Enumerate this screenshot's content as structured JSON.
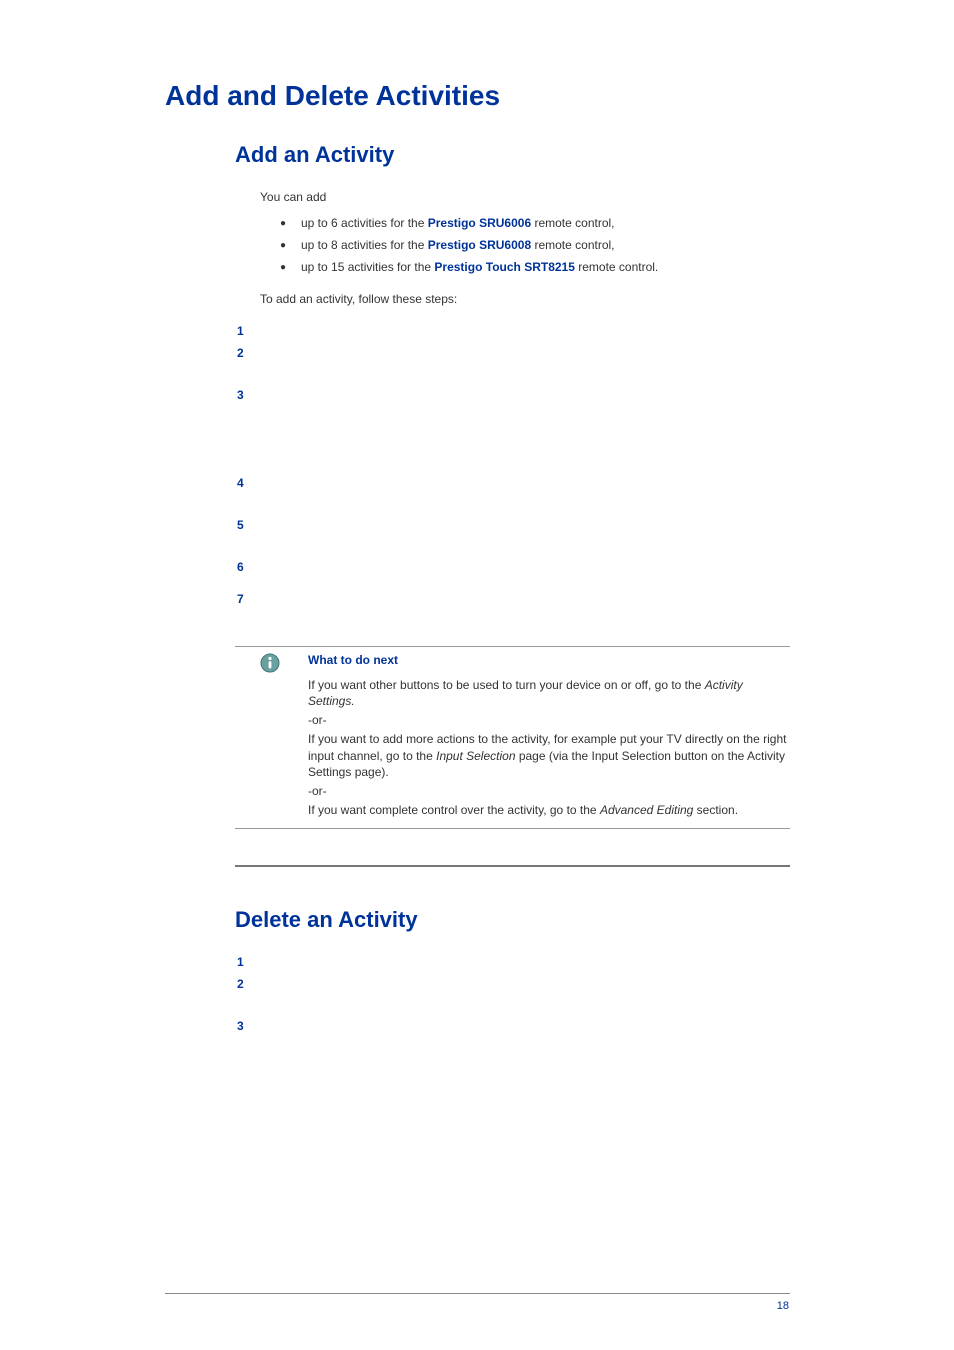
{
  "h1": "Add and Delete Activities",
  "sectionAdd": {
    "h2": "Add an Activity",
    "intro": "You can add",
    "bullets": [
      {
        "pre": "up to 6 activities for the ",
        "bold": "Prestigo SRU6006",
        "post": " remote control,"
      },
      {
        "pre": "up to 8 activities for the ",
        "bold": "Prestigo SRU6008",
        "post": " remote control,"
      },
      {
        "pre": "up to 15 activities for the ",
        "bold": "Prestigo Touch SRT8215",
        "post": " remote control."
      }
    ],
    "follow": "To add an activity, follow these steps:",
    "stepNumbers": [
      "1",
      "2",
      "3",
      "4",
      "5",
      "6",
      "7"
    ],
    "info": {
      "heading": "What to do next",
      "p1a": "If you want other buttons to be used to turn your device on or off, go to the ",
      "p1b": "Activity Settings.",
      "or": "-or-",
      "p2a": "If you want to add more actions to the activity, for example put your TV directly on the right input channel, go to the ",
      "p2b": "Input Selection",
      "p2c": " page (via the Input Selection button on the Activity Settings page).",
      "p3a": "If you want complete control over the activity, go to the ",
      "p3b": "Advanced Editing",
      "p3c": " section."
    }
  },
  "sectionDelete": {
    "h2": "Delete an Activity",
    "stepNumbers": [
      "1",
      "2",
      "3"
    ]
  },
  "pageNumber": "18"
}
